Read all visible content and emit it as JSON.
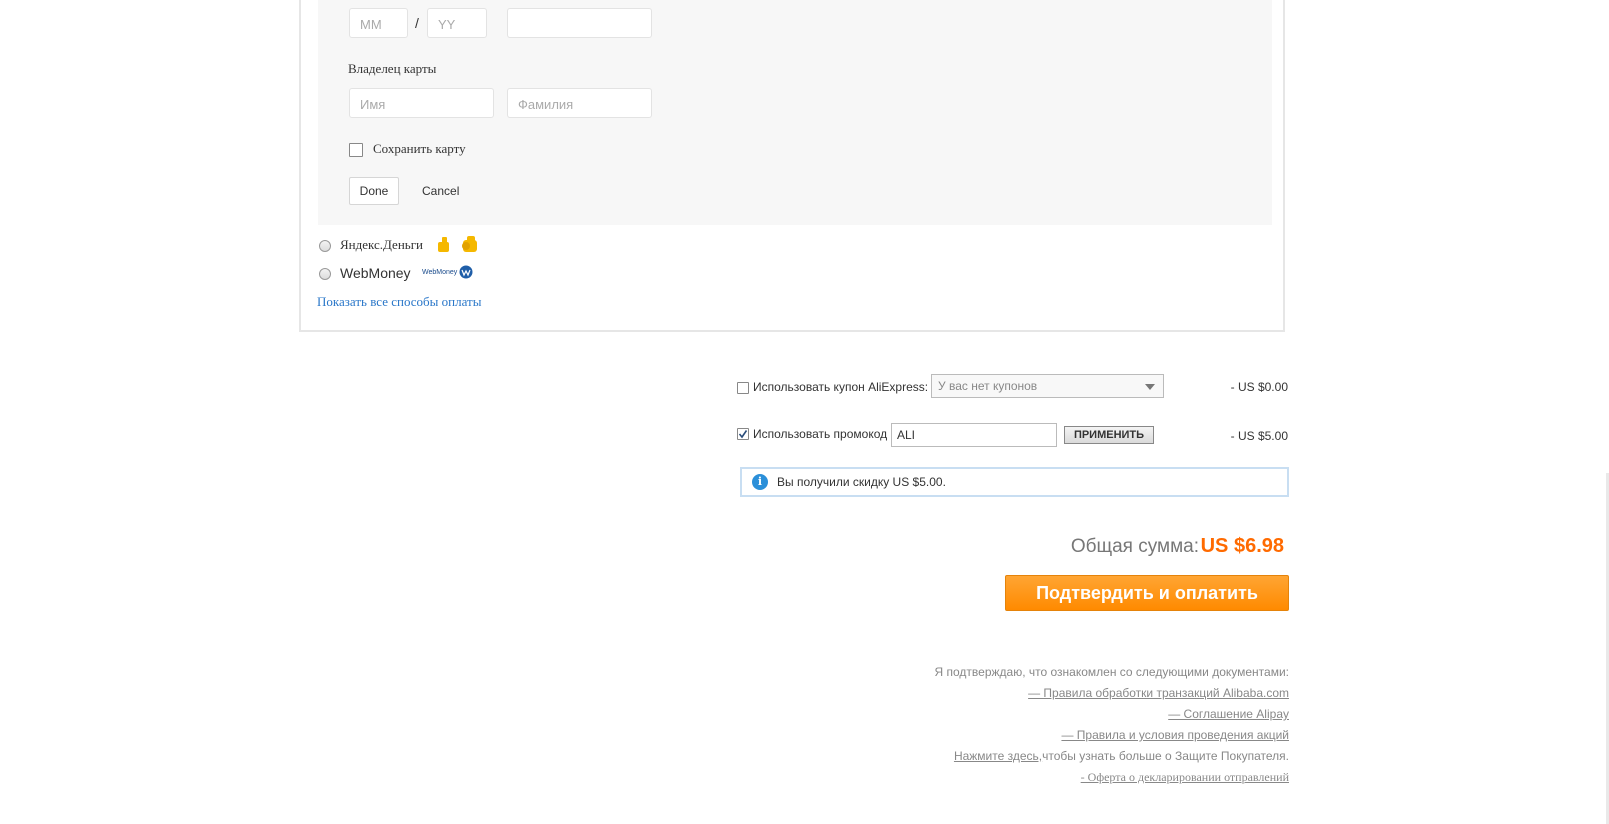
{
  "card_form": {
    "month_placeholder": "MM",
    "year_placeholder": "YY",
    "slash": "/",
    "owner_label": "Владелец карты",
    "first_name_placeholder": "Имя",
    "last_name_placeholder": "Фамилия",
    "save_card_label": "Сохранить карту",
    "done_label": "Done",
    "cancel_label": "Cancel"
  },
  "payment_methods": [
    {
      "label": "Яндекс.Деньги",
      "icon": "yandex-money-icon"
    },
    {
      "label": "WebMoney",
      "icon": "webmoney-icon",
      "logo_text": "WebMoney"
    }
  ],
  "show_all_methods": "Показать все способы оплаты",
  "coupon": {
    "label": "Использовать купон AliExpress:",
    "select_value": "У вас нет купонов",
    "amount": "- US $0.00",
    "checked": false
  },
  "promo": {
    "label": "Использовать промокод",
    "value": "ALI",
    "apply_label": "ПРИМЕНИТЬ",
    "amount": "- US $5.00",
    "checked": true
  },
  "notice": {
    "text": "Вы получили скидку US $5.00.",
    "icon": "info-icon"
  },
  "total": {
    "label": "Общая сумма:",
    "value": "US $6.98"
  },
  "pay_button": "Подтвердить и оплатить",
  "documents": {
    "intro": "Я подтверждаю, что ознакомлен со следующими документами:",
    "link1": "— Правила обработки транзакций Alibaba.com",
    "link2": "— Соглашение Alipay",
    "link3": "— Правила и условия проведения акций",
    "buyer_link": "Нажмите здесь,",
    "buyer_text": "чтобы узнать больше о Защите Покупателя.",
    "link4": "- Оферта о декларировании отправлений"
  },
  "colors": {
    "accent": "#ff6a00",
    "pay_button": "#ff9a1a",
    "link": "#2a77c9",
    "notice_border": "#c8def2"
  }
}
